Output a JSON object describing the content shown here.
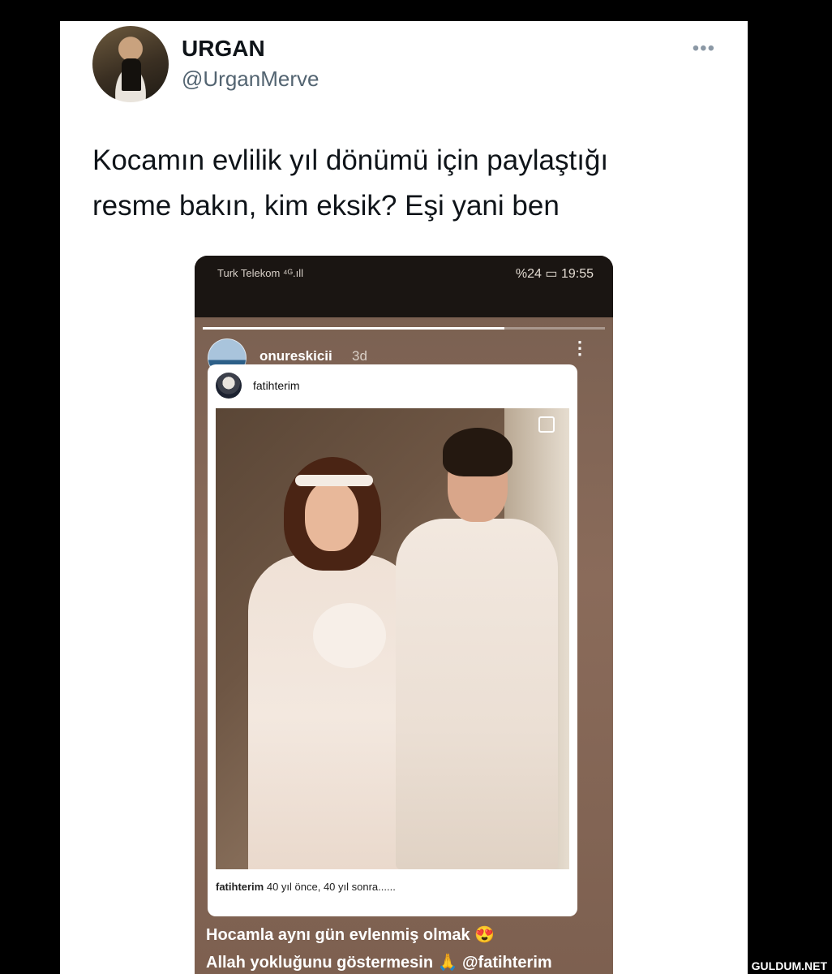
{
  "tweet": {
    "display_name": "URGAN",
    "handle": "@UrganMerve",
    "more_icon": "•••",
    "text_line1": "Kocamın evlilik yıl dönümü için paylaştığı",
    "text_line2": "resme bakın, kim eksik? Eşi yani ben"
  },
  "phone": {
    "carrier": "Turk Telekom",
    "signal_icon": "⁴ᴳ.ıll",
    "battery": "%24",
    "battery_icon": "▭",
    "time": "19:55",
    "story_progress": 0.75,
    "story_user": "onureskicii",
    "story_time": "3d",
    "kebab_icon": "⋮",
    "post_user": "fatihterim",
    "caption_user": "fatihterim",
    "caption_text": " 40 yıl önce, 40 yıl sonra......",
    "overlay_line1": "Hocamla aynı gün evlenmiş olmak 😍",
    "overlay_line2": "Allah yokluğunu göstermesin 🙏 @fatihterim"
  },
  "watermark": "GULDUM.NET"
}
